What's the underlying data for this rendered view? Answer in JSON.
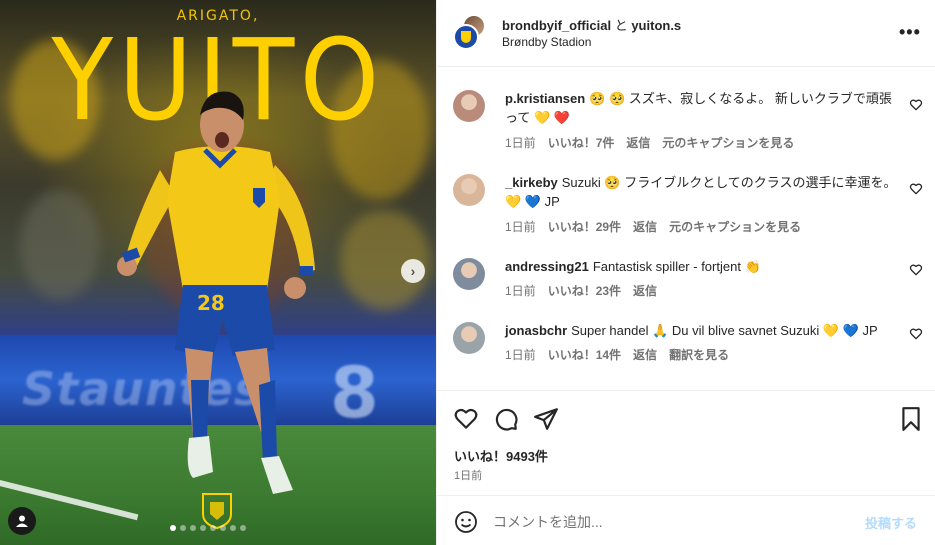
{
  "media": {
    "overlay_small": "ARIGATO,",
    "overlay_big": "YUITO",
    "jersey_number": "28",
    "banner_text": "Stauntes",
    "slide_count": 8,
    "active_slide": 1,
    "colors": {
      "yellow": "#ffd000",
      "blue": "#1c4aa8",
      "pitch": "#3b7a30"
    }
  },
  "header": {
    "author": "brondbyif_official",
    "conjunction": "と",
    "collaborator": "yuiton.s",
    "location": "Brøndby Stadion",
    "more_icon": "more-horizontal-icon"
  },
  "comments": [
    {
      "username": "p.kristiansen",
      "text": "🥺 🥺 スズキ、寂しくなるよ。 新しいクラブで頑張って 💛 ❤️",
      "time": "1日前",
      "likes": "いいね！7件",
      "reply": "返信",
      "extra": "元のキャプションを見る",
      "avatar_color": "#b98b7b"
    },
    {
      "username": "_kirkeby",
      "text": "Suzuki 🥺 フライブルクとしてのクラスの選手に幸運を。 💛 💙 JP",
      "time": "1日前",
      "likes": "いいね！29件",
      "reply": "返信",
      "extra": "元のキャプションを見る",
      "avatar_color": "#d9b59a"
    },
    {
      "username": "andressing21",
      "text": "Fantastisk spiller - fortjent 👏",
      "time": "1日前",
      "likes": "いいね！23件",
      "reply": "返信",
      "extra": "",
      "avatar_color": "#7f8c9d"
    },
    {
      "username": "jonasbchr",
      "text": "Super handel 🙏 Du vil blive savnet Suzuki 💛 💙 JP",
      "time": "1日前",
      "likes": "いいね！14件",
      "reply": "返信",
      "extra": "翻訳を見る",
      "avatar_color": "#9aa3a8"
    }
  ],
  "actions": {
    "like_icon": "heart-icon",
    "comment_icon": "comment-bubble-icon",
    "share_icon": "paper-plane-icon",
    "save_icon": "bookmark-icon",
    "likes_count": "いいね！9493件",
    "posted": "1日前"
  },
  "composer": {
    "emoji_icon": "smiley-icon",
    "placeholder": "コメントを追加...",
    "value": "",
    "post_label": "投稿する"
  }
}
